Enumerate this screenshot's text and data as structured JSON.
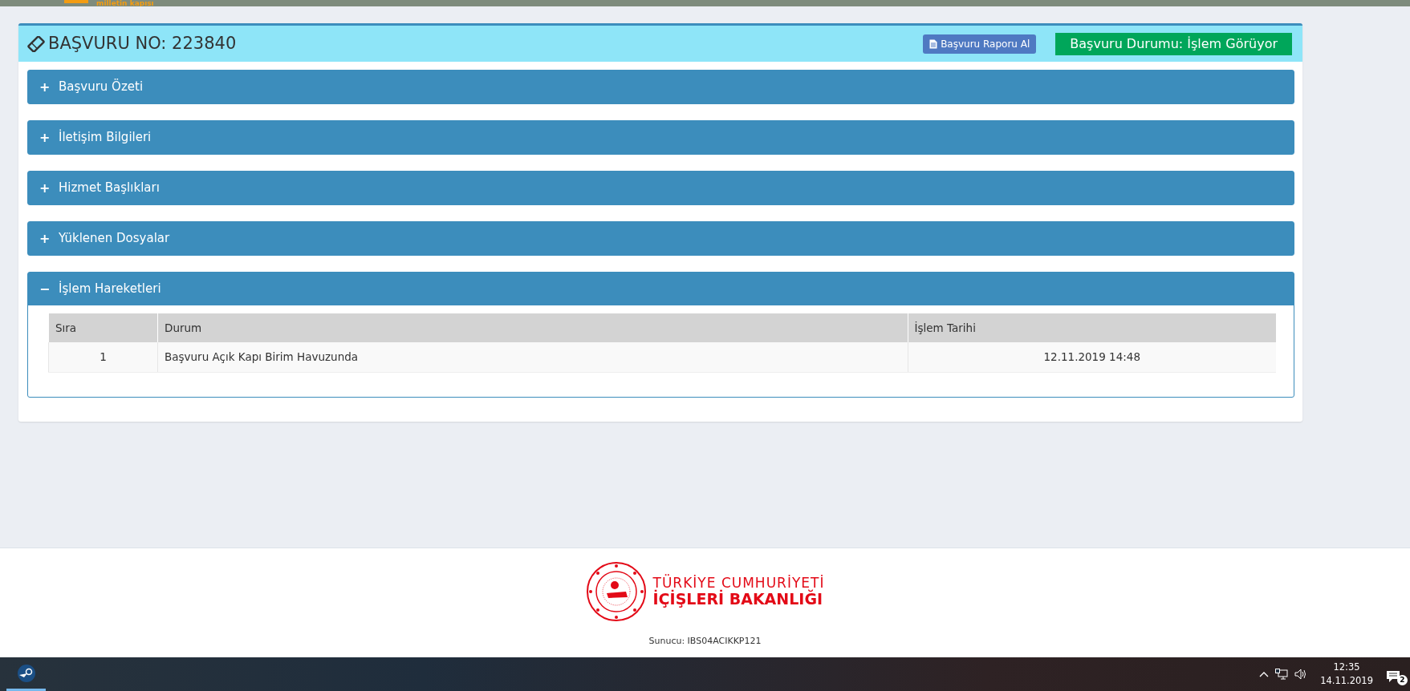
{
  "top_bar": {
    "tagline": "milletin kapısı"
  },
  "application": {
    "title": "BAŞVURU NO: 223840",
    "report_button": "Başvuru Raporu Al",
    "status": "Başvuru Durumu: İşlem Görüyor"
  },
  "panels": [
    {
      "title": "Başvuru Özeti",
      "icon": "+",
      "expanded": false
    },
    {
      "title": "İletişim Bilgileri",
      "icon": "+",
      "expanded": false
    },
    {
      "title": "Hizmet Başlıkları",
      "icon": "+",
      "expanded": false
    },
    {
      "title": "Yüklenen Dosyalar",
      "icon": "+",
      "expanded": false
    },
    {
      "title": "İşlem Hareketleri",
      "icon": "−",
      "expanded": true,
      "table": {
        "columns": [
          "Sıra",
          "Durum",
          "İşlem Tarihi"
        ],
        "rows": [
          [
            "1",
            "Başvuru Açık Kapı Birim Havuzunda",
            "12.11.2019 14:48"
          ]
        ]
      }
    }
  ],
  "footer": {
    "logo_line_1": "TÜRKİYE CUMHURİYETİ",
    "logo_line_2": "İÇİŞLERİ BAKANLIĞI",
    "server": "Sunucu: IBS04ACIKKP121"
  },
  "taskbar": {
    "time": "12:35",
    "date": "14.11.2019",
    "notifications": "2"
  }
}
